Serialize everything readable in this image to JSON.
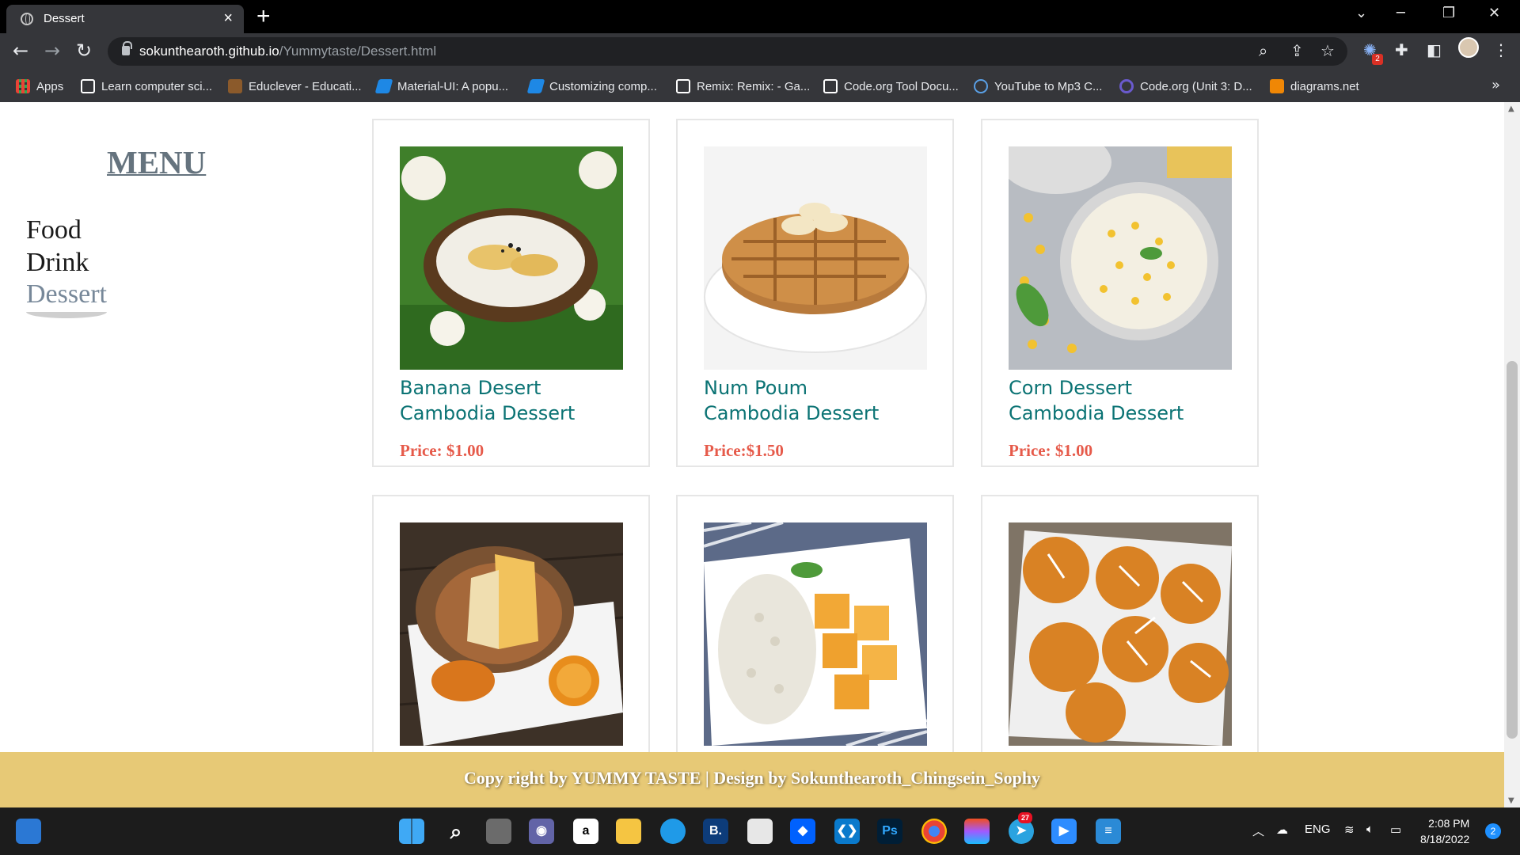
{
  "browser": {
    "tab_title": "Dessert",
    "url_host": "sokunthearoth.github.io",
    "url_path": "/Yummytaste/Dessert.html",
    "extension_badge": "2"
  },
  "bookmarks": [
    {
      "label": "Apps",
      "color": "#4285f4"
    },
    {
      "label": "Learn computer sci...",
      "color": "#ffffff"
    },
    {
      "label": "Educlever - Educati...",
      "color": "#8b5a2b"
    },
    {
      "label": "Material-UI: A popu...",
      "color": "#1e88e5"
    },
    {
      "label": "Customizing comp...",
      "color": "#1e88e5"
    },
    {
      "label": "Remix: Remix: - Ga...",
      "color": "#ffffff"
    },
    {
      "label": "Code.org Tool Docu...",
      "color": "#ffffff"
    },
    {
      "label": "YouTube to Mp3 C...",
      "color": "#5aa0e6"
    },
    {
      "label": "Code.org (Unit 3: D...",
      "color": "#6a5acd"
    },
    {
      "label": "diagrams.net",
      "color": "#f08705"
    }
  ],
  "sidebar": {
    "title": "MENU",
    "links": [
      {
        "label": "Food",
        "active": false
      },
      {
        "label": "Drink",
        "active": false
      },
      {
        "label": "Dessert",
        "active": true
      }
    ]
  },
  "cards": [
    {
      "name": "Banana Desert",
      "origin": "Cambodia Dessert",
      "price": "Price: $1.00",
      "photo": "banana-coconut-dessert"
    },
    {
      "name": "Num Poum",
      "origin": "Cambodia Dessert",
      "price": "Price:$1.50",
      "photo": "waffle-with-banana"
    },
    {
      "name": "Corn Dessert",
      "origin": "Cambodia Dessert",
      "price": "Price: $1.00",
      "photo": "corn-pudding-bowl"
    },
    {
      "name": "",
      "origin": "",
      "price": "",
      "photo": "pumpkin-custard"
    },
    {
      "name": "",
      "origin": "",
      "price": "",
      "photo": "mango-sticky-rice"
    },
    {
      "name": "",
      "origin": "",
      "price": "",
      "photo": "pumpkin-cakes-coconut"
    }
  ],
  "footer": {
    "text": "Copy right by YUMMY TASTE | Design by Sokunthearoth_Chingsein_Sophy"
  },
  "taskbar": {
    "language": "ENG",
    "time": "2:08 PM",
    "date": "8/18/2022",
    "notification_count": "2",
    "telegram_badge": "27"
  },
  "colors": {
    "accent_teal": "#0b7374",
    "price_red": "#e65a4a",
    "footer_gold": "#e7c976",
    "menu_gray": "#65737e"
  }
}
